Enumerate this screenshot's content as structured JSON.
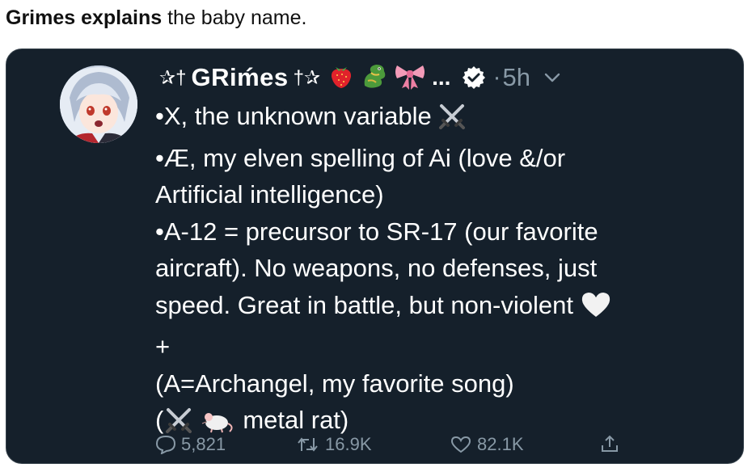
{
  "caption": {
    "bold": "Grimes explains",
    "rest": " the baby name."
  },
  "tweet": {
    "display_name": "GRiḿes",
    "deco_left": "✰†",
    "deco_right": "†✰",
    "emojis": [
      "strawberry",
      "dragon",
      "ribbon"
    ],
    "ellipsis": "...",
    "dot": "·",
    "time": "5h",
    "lines": [
      "•X, the unknown variable",
      "•Æ, my elven spelling of Ai (love &/or",
      "Artificial intelligence)",
      "•A-12 = precursor to SR-17 (our favorite",
      "aircraft).  No weapons, no defenses, just",
      "speed.  Great in battle, but non-violent",
      "+",
      "(A=Archangel, my favorite song)",
      "metal rat)"
    ],
    "line9_prefix": "(",
    "stats": {
      "replies": "5,821",
      "retweets": "16.9K",
      "likes": "82.1K"
    }
  },
  "colors": {
    "card_bg": "#15202b",
    "muted": "#8899a6",
    "text": "#ffffff"
  }
}
